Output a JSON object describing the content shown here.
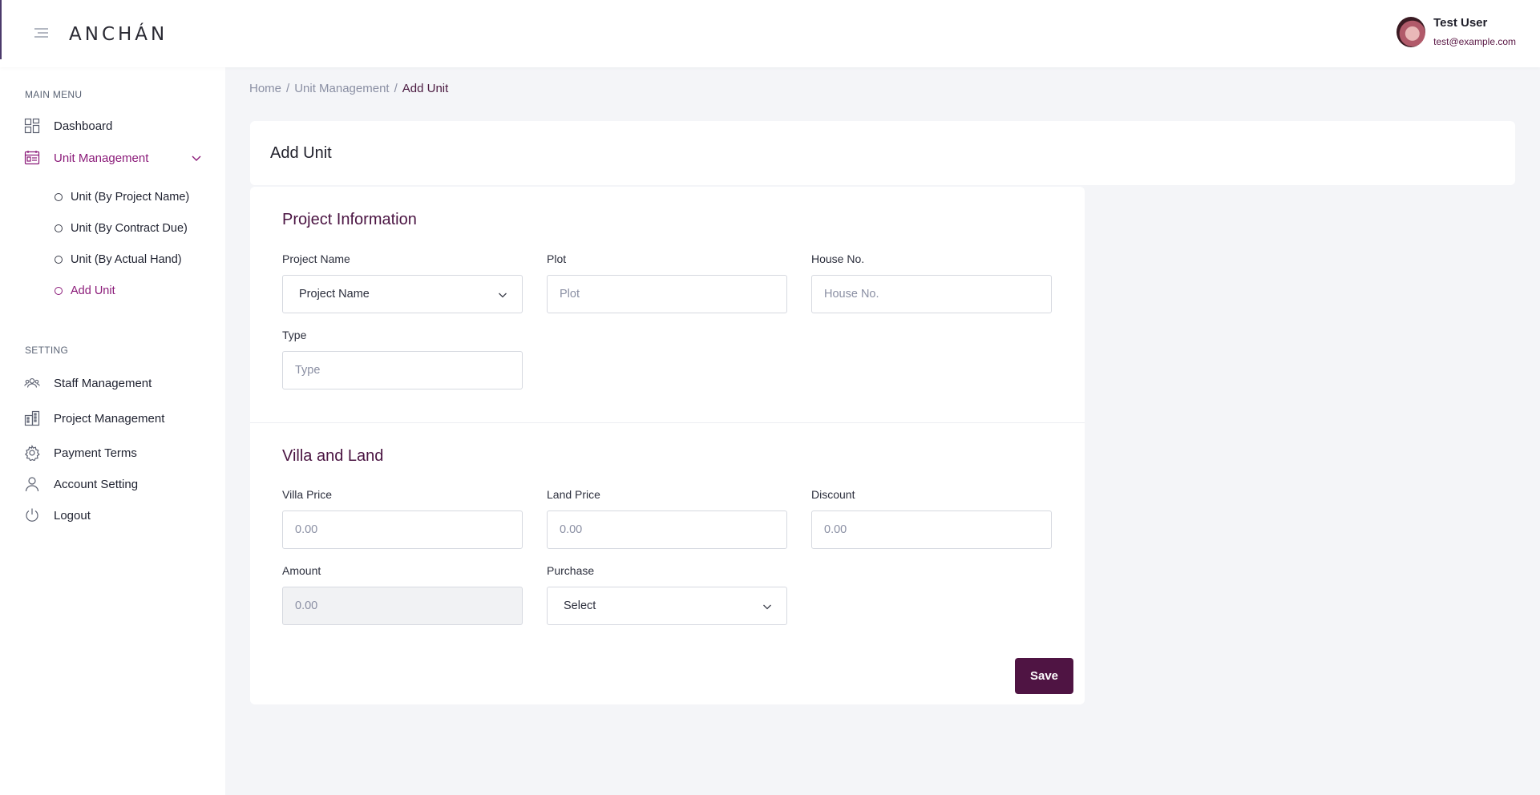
{
  "header": {
    "logo": "ANCHÁN",
    "user_name": "Test User",
    "user_email": "test@example.com"
  },
  "sidebar": {
    "main_menu_label": "MAIN MENU",
    "setting_label": "SETTING",
    "items": [
      {
        "label": "Dashboard",
        "icon": "dashboard-icon"
      },
      {
        "label": "Unit Management",
        "icon": "unit-management-icon",
        "active": true
      },
      {
        "label": "Staff Management",
        "icon": "staff-icon"
      },
      {
        "label": "Project Management",
        "icon": "building-icon"
      },
      {
        "label": "Payment Terms",
        "icon": "gear-icon"
      },
      {
        "label": "Account Setting",
        "icon": "user-icon"
      },
      {
        "label": "Logout",
        "icon": "power-icon"
      }
    ],
    "sub_items": [
      {
        "label": "Unit (By Project Name)"
      },
      {
        "label": "Unit (By Contract Due)"
      },
      {
        "label": "Unit (By Actual Hand)"
      },
      {
        "label": "Add Unit",
        "active": true
      }
    ]
  },
  "breadcrumb": {
    "home": "Home",
    "sep1": "/",
    "unit_management": "Unit Management",
    "sep2": "/",
    "current": "Add Unit"
  },
  "page": {
    "title": "Add Unit"
  },
  "project_info": {
    "title": "Project Information",
    "project_name": {
      "label": "Project Name",
      "value": "Project Name"
    },
    "plot": {
      "label": "Plot",
      "placeholder": "Plot"
    },
    "house_no": {
      "label": "House No.",
      "placeholder": "House No."
    },
    "type": {
      "label": "Type",
      "placeholder": "Type"
    }
  },
  "villa_land": {
    "title": "Villa and Land",
    "villa_price": {
      "label": "Villa Price",
      "placeholder": "0.00"
    },
    "land_price": {
      "label": "Land Price",
      "placeholder": "0.00"
    },
    "discount": {
      "label": "Discount",
      "placeholder": "0.00"
    },
    "amount": {
      "label": "Amount",
      "placeholder": "0.00"
    },
    "purchase": {
      "label": "Purchase",
      "value": "Select"
    }
  },
  "actions": {
    "save_label": "Save"
  },
  "colors": {
    "accent": "#8b1b79",
    "primary": "#4f1443",
    "background": "#f4f5f8"
  }
}
